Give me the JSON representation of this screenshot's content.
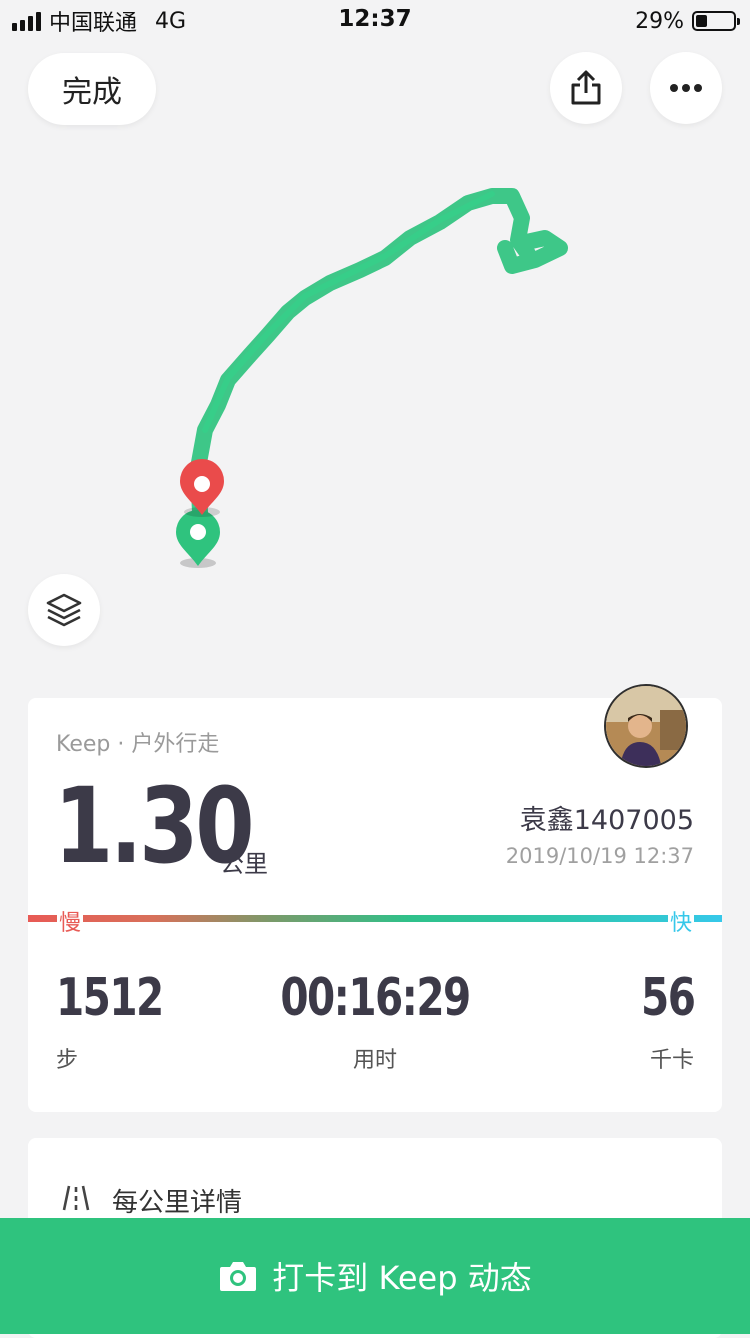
{
  "status_bar": {
    "carrier": "中国联通",
    "network": "4G",
    "time": "12:37",
    "battery": "29%"
  },
  "top_bar": {
    "done_label": "完成",
    "share_icon": "share-icon",
    "more_icon": "more-icon"
  },
  "map": {
    "route_color": "#2fc37e",
    "start_marker_color": "#2fc37e",
    "end_marker_color": "#ea4b4b",
    "layers_icon": "layers-icon"
  },
  "summary": {
    "source": "Keep · 户外行走",
    "distance": "1.30",
    "distance_unit": "公里",
    "username": "袁鑫1407005",
    "datetime": "2019/10/19 12:37",
    "pace_slow": "慢",
    "pace_fast": "快",
    "stats": [
      {
        "value": "1512",
        "label": "步"
      },
      {
        "value": "00:16:29",
        "label": "用时"
      },
      {
        "value": "56",
        "label": "千卡"
      }
    ]
  },
  "detail_card": {
    "title": "每公里详情"
  },
  "bottom_bar": {
    "label": "打卡到 Keep 动态"
  },
  "colors": {
    "accent": "#2fc37e",
    "text_dark": "#3c3a48",
    "slow": "#e85a55",
    "fast": "#36c8ea"
  }
}
